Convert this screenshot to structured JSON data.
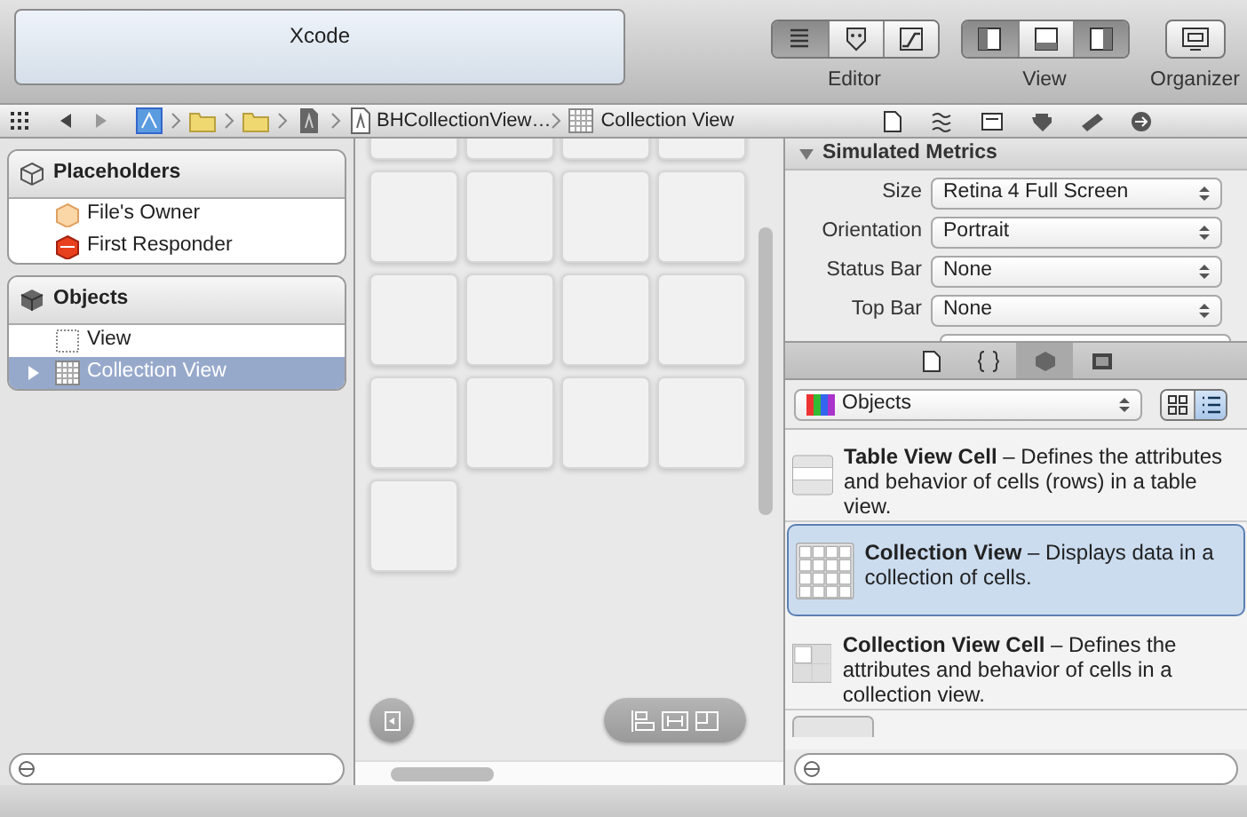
{
  "window": {
    "title": "Xcode"
  },
  "toolbar": {
    "editor": {
      "label": "Editor",
      "segments": [
        {
          "selected": true
        },
        {
          "selected": false
        },
        {
          "selected": false
        }
      ]
    },
    "view": {
      "label": "View",
      "segments": [
        {
          "selected": true
        },
        {
          "selected": false
        },
        {
          "selected": true
        }
      ]
    },
    "organizer": {
      "label": "Organizer"
    }
  },
  "jump_bar": {
    "path": [
      "BHCollectionView…",
      "Collection View"
    ]
  },
  "outline": {
    "sections": [
      {
        "title": "Placeholders",
        "items": [
          {
            "label": "File's Owner",
            "kind": "owner",
            "selected": false
          },
          {
            "label": "First Responder",
            "kind": "responder",
            "selected": false
          }
        ]
      },
      {
        "title": "Objects",
        "items": [
          {
            "label": "View",
            "kind": "view",
            "selected": false
          },
          {
            "label": "Collection View",
            "kind": "collection",
            "selected": true,
            "expanded": false
          }
        ]
      }
    ]
  },
  "simulated_metrics": {
    "title": "Simulated Metrics",
    "expanded": true,
    "fields": [
      {
        "label": "Size",
        "value": "Retina 4 Full Screen"
      },
      {
        "label": "Orientation",
        "value": "Portrait"
      },
      {
        "label": "Status Bar",
        "value": "None"
      },
      {
        "label": "Top Bar",
        "value": "None"
      }
    ]
  },
  "library": {
    "tabs": [
      {
        "selected": false
      },
      {
        "selected": false
      },
      {
        "selected": true
      },
      {
        "selected": false
      }
    ],
    "popup": "Objects",
    "view_modes": [
      {
        "selected": false
      },
      {
        "selected": true
      }
    ],
    "items": [
      {
        "kind": "table-cell",
        "text": "**Table View Cell** – Defines the attributes and behavior of cells (rows) in a table view.",
        "selected": false
      },
      {
        "kind": "collection",
        "text": "**Collection View** – Displays data in a collection of cells.",
        "selected": true
      },
      {
        "kind": "collection-cell",
        "text": "**Collection View Cell** – Defines the attributes and behavior of cells in a collection view.",
        "selected": false
      }
    ]
  }
}
